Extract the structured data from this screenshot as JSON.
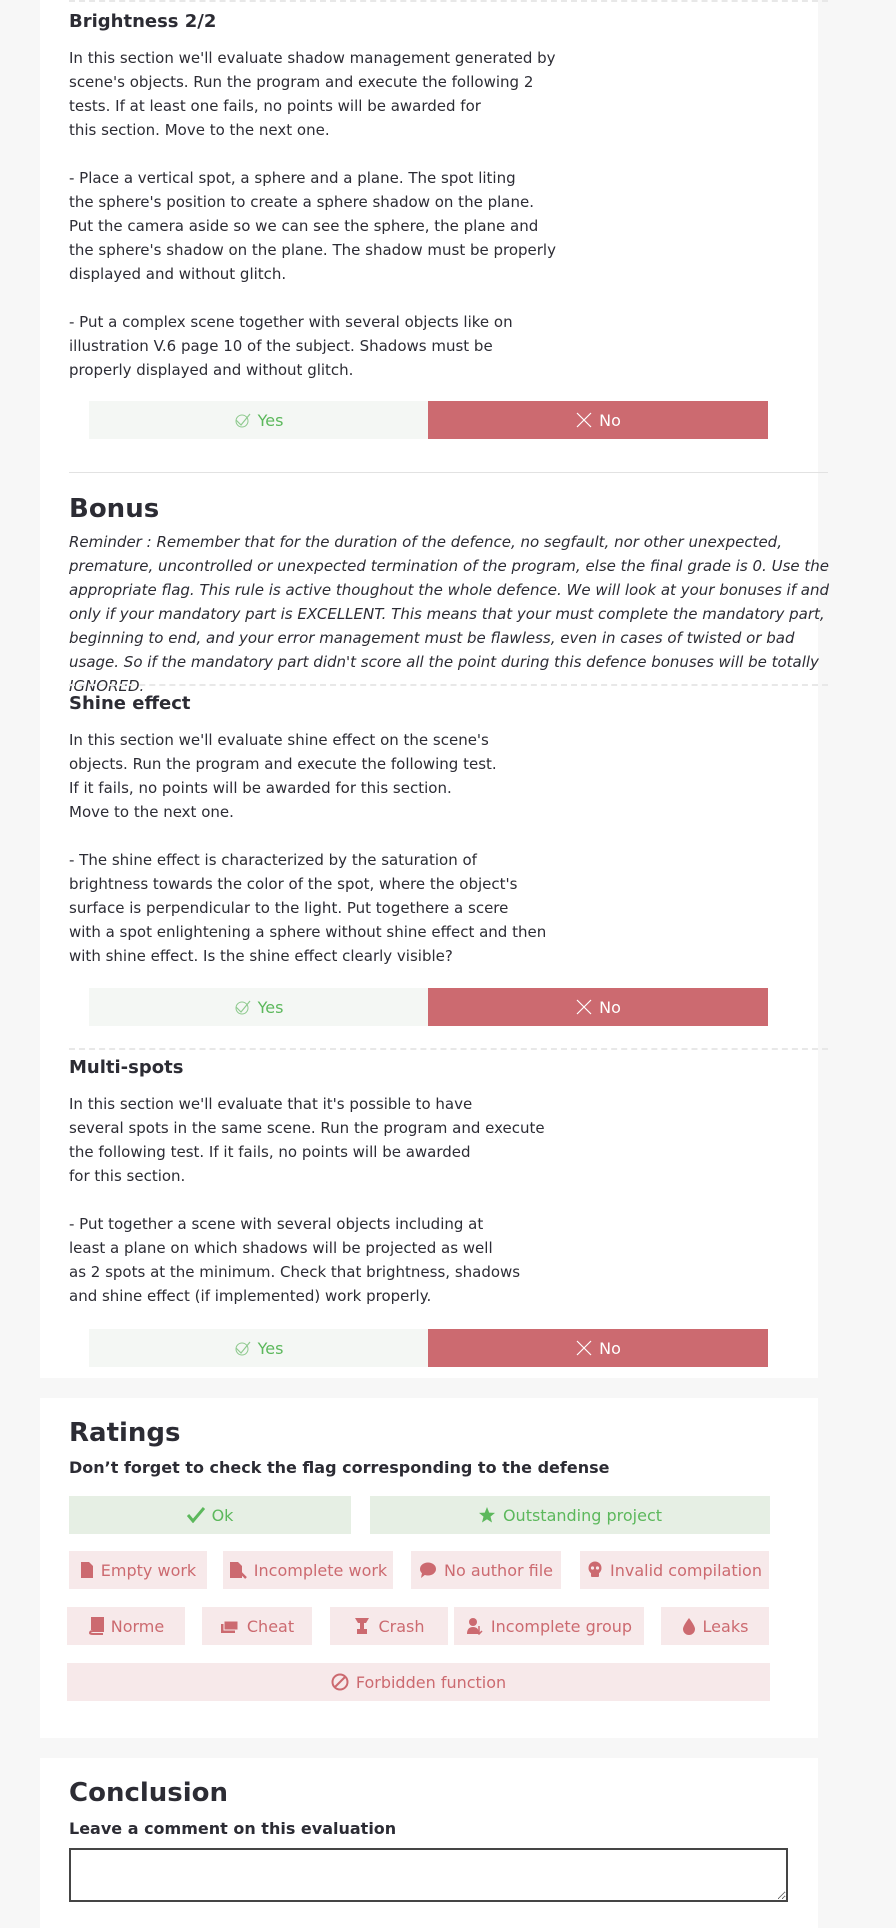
{
  "sections": [
    {
      "title": "Brightness 2/2",
      "body": "In this section we'll evaluate shadow management generated by\nscene's objects. Run the program and execute the following 2\ntests. If at least one fails, no points will be awarded for\nthis section. Move to the next one.\n\n- Place a vertical spot, a sphere and a plane. The spot liting\nthe sphere's position to create a sphere shadow on the plane.\nPut the camera aside so we can see the sphere, the plane and\nthe sphere's shadow on the plane. The shadow must be properly\ndisplayed and without glitch.\n\n- Put a complex scene together with several objects like on\nillustration V.6 page 10 of the subject. Shadows must be\nproperly displayed and without glitch.",
      "yes_label": "Yes",
      "no_label": "No"
    },
    {
      "title": "Shine effect",
      "body": "In this section we'll evaluate shine effect on the scene's\nobjects. Run the program and execute the following test.\nIf it fails, no points will be awarded for this section.\nMove to the next one.\n\n- The shine effect is characterized by the saturation of\nbrightness towards the color of the spot, where the object's\nsurface is perpendicular to the light. Put togethere a scere\nwith a spot enlightening a sphere without shine effect and then\nwith shine effect. Is the shine effect clearly visible?",
      "yes_label": "Yes",
      "no_label": "No"
    },
    {
      "title": "Multi-spots",
      "body": "In this section we'll evaluate that it's possible to have\nseveral spots in the same scene. Run the program and execute\nthe following test. If it fails, no points will be awarded\nfor this section.\n\n- Put together a scene with several objects including at\nleast a plane on which shadows will be projected as well\nas 2 spots at the minimum. Check that brightness, shadows\nand shine effect (if implemented) work properly.",
      "yes_label": "Yes",
      "no_label": "No"
    }
  ],
  "bonus": {
    "title": "Bonus",
    "reminder": "Reminder : Remember that for the duration of the defence, no segfault, nor other unexpected, premature, uncontrolled or unexpected termination of the program, else the final grade is 0. Use the appropriate flag. This rule is active thoughout the whole defence. We will look at your bonuses if and only if your mandatory part is EXCELLENT. This means that your must complete the mandatory part, beginning to end, and your error management must be flawless, even in cases of twisted or bad usage. So if the mandatory part didn't score all the point during this defence bonuses will be totally IGNORED."
  },
  "ratings": {
    "title": "Ratings",
    "subtitle": "Don’t forget to check the flag corresponding to the defense",
    "flags": {
      "ok": "Ok",
      "outstanding": "Outstanding project",
      "empty_work": "Empty work",
      "incomplete_work": "Incomplete work",
      "no_author_file": "No author file",
      "invalid_compilation": "Invalid compilation",
      "norme": "Norme",
      "cheat": "Cheat",
      "crash": "Crash",
      "incomplete_group": "Incomplete group",
      "leaks": "Leaks",
      "forbidden_function": "Forbidden function"
    }
  },
  "conclusion": {
    "title": "Conclusion",
    "subtitle": "Leave a comment on this evaluation",
    "comment_value": ""
  },
  "colors": {
    "yes_text": "#5cb85c",
    "no_background": "#cc6a70",
    "good_flag_background": "#e6efe4",
    "bad_flag_background": "#f7e9ea"
  }
}
